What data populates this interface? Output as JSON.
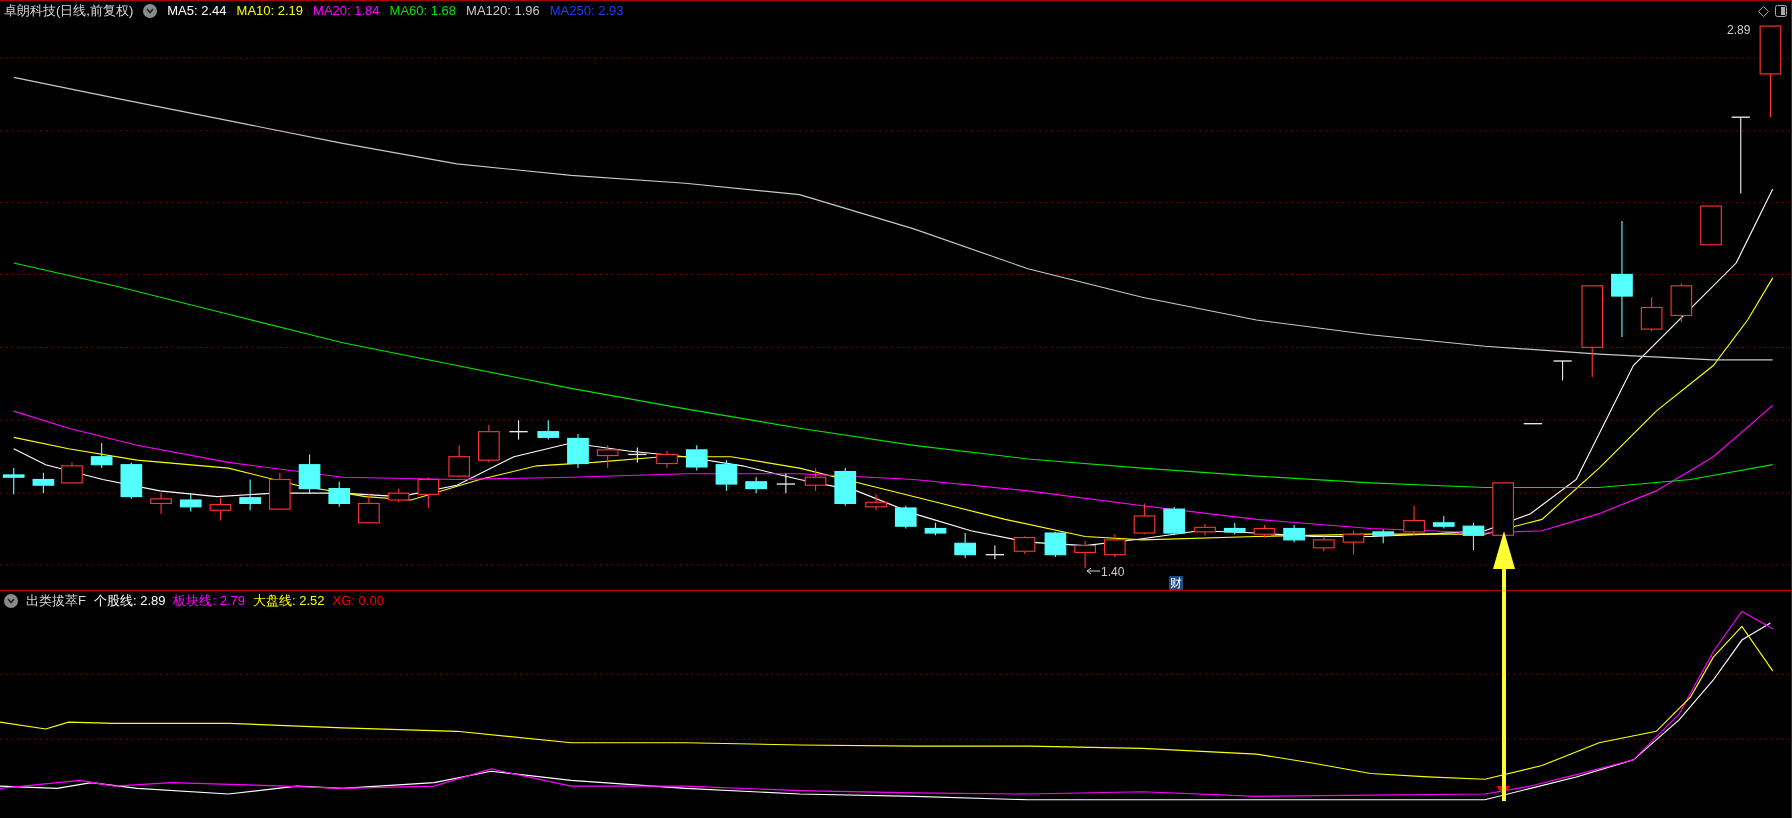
{
  "main_chart": {
    "title": "卓朗科技(日线,前复权)",
    "indicators": [
      {
        "label": "MA5: 2.44",
        "color": "#ffffff"
      },
      {
        "label": "MA10: 2.19",
        "color": "#ffff00"
      },
      {
        "label": "MA20: 1.84",
        "color": "#ff00ff"
      },
      {
        "label": "MA60: 1.68",
        "color": "#00e600"
      },
      {
        "label": "MA120: 1.96",
        "color": "#c8c8c8"
      },
      {
        "label": "MA250: 2.93",
        "color": "#1f3cff"
      }
    ],
    "max_label": "2.89",
    "min_label": "1.40",
    "event_badge": "财"
  },
  "sub_chart": {
    "title": "出类拔萃F",
    "indicators": [
      {
        "label": "个股线: 2.89",
        "color": "#ffffff"
      },
      {
        "label": "板块线: 2.79",
        "color": "#ff00ff"
      },
      {
        "label": "大盘线: 2.52",
        "color": "#ffff00"
      },
      {
        "label": "XG: 0.00",
        "color": "#ff0000"
      }
    ]
  }
}
